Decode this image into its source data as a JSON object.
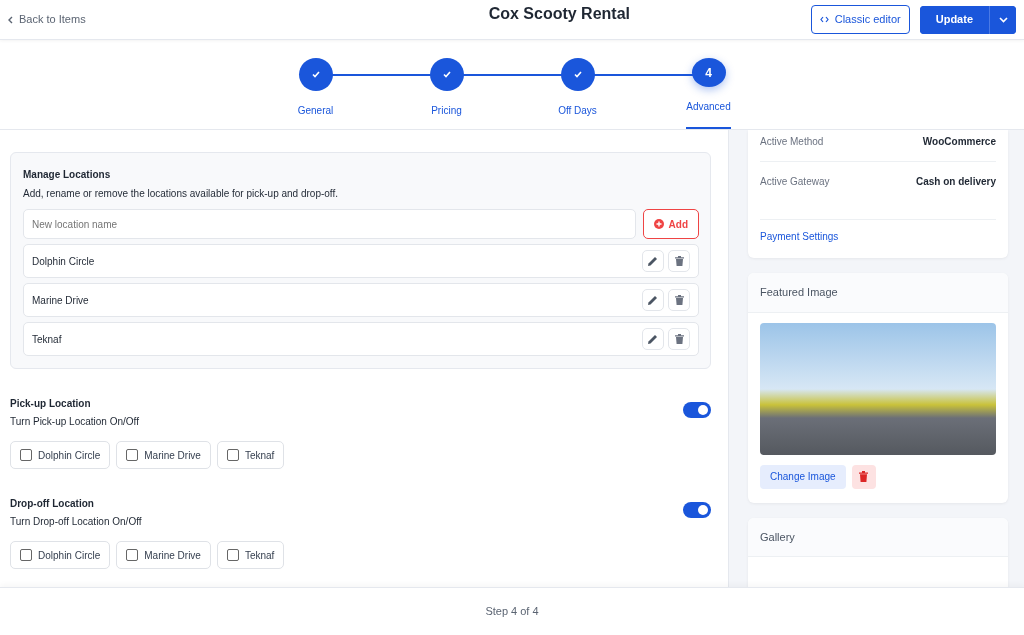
{
  "header": {
    "back_link": "Back to Items",
    "title": "Cox Scooty Rental",
    "classic_editor": "Classic editor",
    "update_button": "Update"
  },
  "steps": [
    {
      "label": "General",
      "kind": "done",
      "selected": false
    },
    {
      "label": "Pricing",
      "kind": "done",
      "selected": false
    },
    {
      "label": "Off Days",
      "kind": "done",
      "selected": false
    },
    {
      "label": "Advanced",
      "kind": "current",
      "number": "4",
      "selected": true
    }
  ],
  "manage_locations": {
    "title": "Manage Locations",
    "description": "Add, rename or remove the locations available for pick-up and drop-off.",
    "input": {
      "placeholder": "New location name"
    },
    "add_button": "Add",
    "locations": [
      {
        "name": "Dolphin Circle"
      },
      {
        "name": "Marine Drive"
      },
      {
        "name": "Teknaf"
      }
    ]
  },
  "location_sections": [
    {
      "title": "Pick-up Location",
      "subtitle": "Turn Pick-up Location On/Off",
      "on": true,
      "options": [
        {
          "label": "Dolphin Circle",
          "checked": false
        },
        {
          "label": "Marine Drive",
          "checked": false
        },
        {
          "label": "Teknaf",
          "checked": false
        }
      ]
    },
    {
      "title": "Drop-off Location",
      "subtitle": "Turn Drop-off Location On/Off",
      "on": true,
      "options": [
        {
          "label": "Dolphin Circle",
          "checked": false
        },
        {
          "label": "Marine Drive",
          "checked": false
        },
        {
          "label": "Teknaf",
          "checked": false
        }
      ]
    }
  ],
  "payment": {
    "rows": [
      {
        "label": "Active Method",
        "value": "WooCommerce"
      },
      {
        "label": "Active Gateway",
        "value": "Cash on delivery"
      }
    ],
    "settings_link": "Payment Settings"
  },
  "featured_image": {
    "title": "Featured Image",
    "change_button": "Change Image"
  },
  "gallery": {
    "title": "Gallery"
  },
  "footer": {
    "step_text": "Step 4 of 4"
  }
}
